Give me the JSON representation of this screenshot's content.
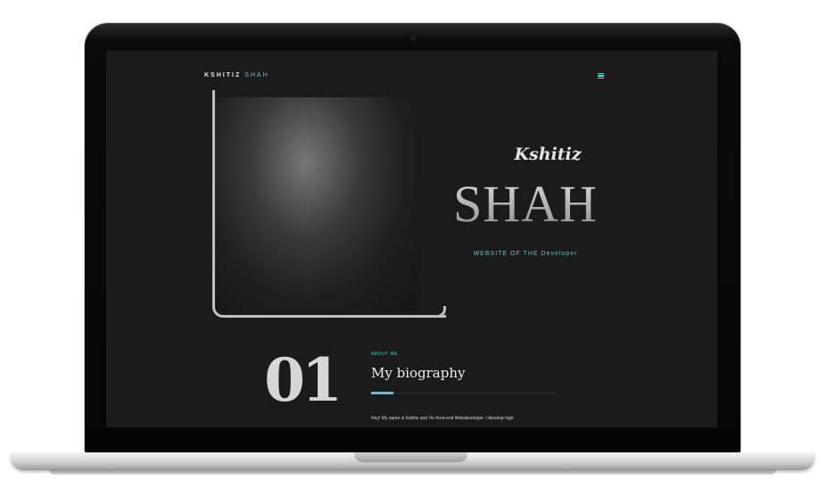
{
  "site": {
    "brand_first": "KSHITIZ",
    "brand_last": "SHAH",
    "menu_icon": "hamburger-menu-icon"
  },
  "hero": {
    "first_name": "Kshitiz",
    "last_name": "SHAH",
    "tagline": "WEBSITE OF THE Developer"
  },
  "about": {
    "number": "01",
    "label": "ABOUT ME",
    "title": "My biography",
    "text": "Hey! My name is Kshitiz and I'm front-end Webdeveloper. I develop high"
  },
  "colors": {
    "accent": "#4fc9c9",
    "background": "#1b1b1b"
  }
}
